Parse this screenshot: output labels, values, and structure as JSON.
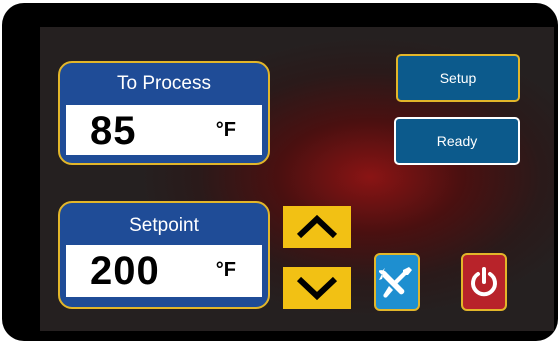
{
  "process": {
    "label": "To Process",
    "value": "85",
    "unit": "°F"
  },
  "setpoint": {
    "label": "Setpoint",
    "value": "200",
    "unit": "°F"
  },
  "buttons": {
    "setup_label": "Setup",
    "ready_label": "Ready"
  },
  "icons": {
    "up": "chevron-up-icon",
    "down": "chevron-down-icon",
    "tools": "wrench-screwdriver-icon",
    "power": "power-icon"
  },
  "colors": {
    "panel_blue": "#1f4c97",
    "gold_border": "#e2b62a",
    "arrow_yellow": "#f2c114",
    "button_blue": "#0c5a8c",
    "tools_blue": "#1e8fd0",
    "power_red": "#b8232a",
    "glow_red": "#8a1414"
  }
}
